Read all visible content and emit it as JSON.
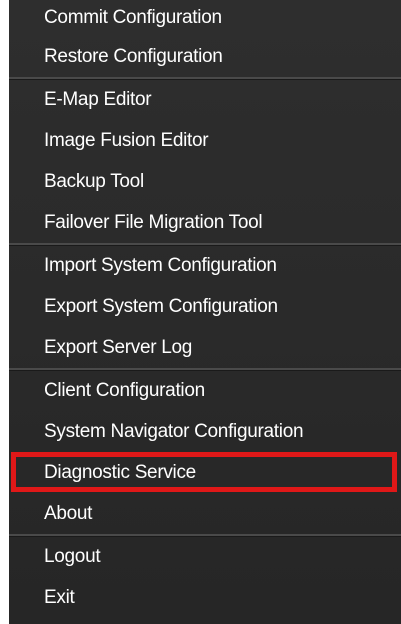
{
  "menu": {
    "groups": [
      {
        "items": [
          {
            "label": "Commit Configuration"
          },
          {
            "label": "Restore Configuration"
          }
        ]
      },
      {
        "items": [
          {
            "label": "E-Map Editor"
          },
          {
            "label": "Image Fusion Editor"
          },
          {
            "label": "Backup Tool"
          },
          {
            "label": "Failover File Migration Tool"
          }
        ]
      },
      {
        "items": [
          {
            "label": "Import System Configuration"
          },
          {
            "label": "Export System Configuration"
          },
          {
            "label": "Export Server Log"
          }
        ]
      },
      {
        "items": [
          {
            "label": "Client Configuration"
          },
          {
            "label": "System Navigator Configuration"
          },
          {
            "label": "Diagnostic Service"
          },
          {
            "label": "About"
          }
        ]
      },
      {
        "items": [
          {
            "label": "Logout"
          },
          {
            "label": "Exit"
          }
        ]
      }
    ],
    "highlight_color": "#e01818",
    "background_color": "#2a2a2a",
    "text_color": "#ffffff"
  }
}
